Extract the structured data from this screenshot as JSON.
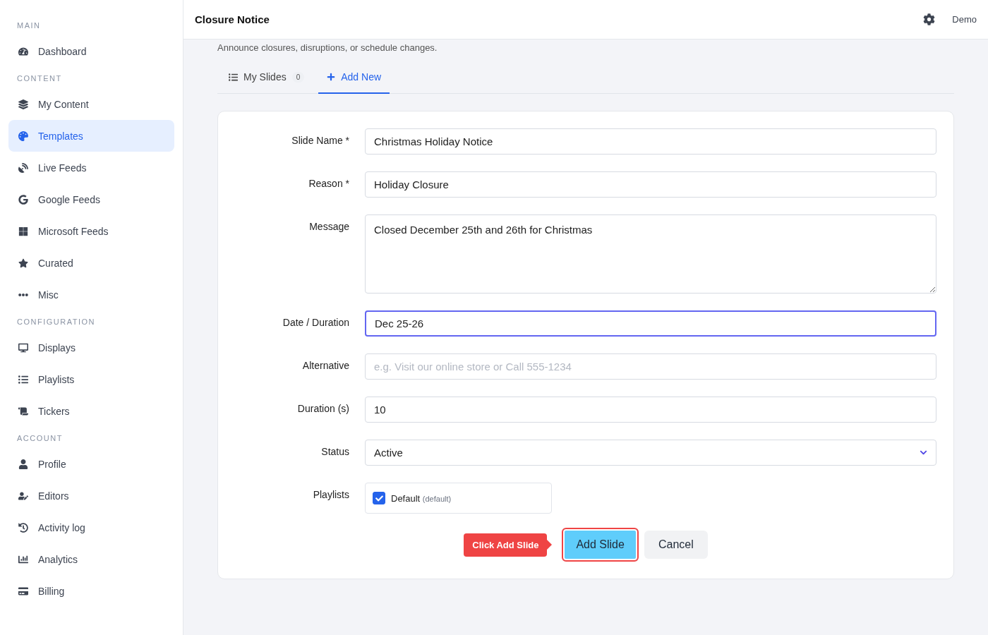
{
  "sidebar": {
    "sections": [
      {
        "heading": "MAIN",
        "items": [
          {
            "label": "Dashboard",
            "selected": false
          }
        ]
      },
      {
        "heading": "CONTENT",
        "items": [
          {
            "label": "My Content",
            "selected": false
          },
          {
            "label": "Templates",
            "selected": true
          },
          {
            "label": "Live Feeds",
            "selected": false
          },
          {
            "label": "Google Feeds",
            "selected": false
          },
          {
            "label": "Microsoft Feeds",
            "selected": false
          },
          {
            "label": "Curated",
            "selected": false
          },
          {
            "label": "Misc",
            "selected": false
          }
        ]
      },
      {
        "heading": "CONFIGURATION",
        "items": [
          {
            "label": "Displays",
            "selected": false
          },
          {
            "label": "Playlists",
            "selected": false
          },
          {
            "label": "Tickers",
            "selected": false
          }
        ]
      },
      {
        "heading": "ACCOUNT",
        "items": [
          {
            "label": "Profile",
            "selected": false
          },
          {
            "label": "Editors",
            "selected": false
          },
          {
            "label": "Activity log",
            "selected": false
          },
          {
            "label": "Analytics",
            "selected": false
          },
          {
            "label": "Billing",
            "selected": false
          }
        ]
      }
    ]
  },
  "header": {
    "title": "Closure Notice",
    "user": "Demo"
  },
  "subtitle": "Announce closures, disruptions, or schedule changes.",
  "tabs": [
    {
      "label": "My Slides",
      "count": "0",
      "selected": false
    },
    {
      "label": "Add New",
      "selected": true
    }
  ],
  "form": {
    "fields": [
      {
        "kind": "text",
        "label": "Slide Name *",
        "value": "Christmas Holiday Notice",
        "focused": false
      },
      {
        "kind": "text",
        "label": "Reason *",
        "value": "Holiday Closure",
        "focused": false
      },
      {
        "kind": "textarea",
        "label": "Message",
        "value": "Closed December 25th and 26th for Christmas"
      },
      {
        "kind": "text",
        "label": "Date / Duration",
        "value": "Dec 25-26",
        "focused": true
      },
      {
        "kind": "text",
        "label": "Alternative",
        "placeholder": "e.g. Visit our online store or Call 555-1234",
        "focused": false
      },
      {
        "kind": "text",
        "label": "Duration (s)",
        "value": "10",
        "focused": false
      },
      {
        "kind": "select",
        "label": "Status",
        "value": "Active"
      },
      {
        "kind": "checkboxes",
        "label": "Playlists",
        "options": [
          {
            "label": "Default",
            "note": "(default)",
            "checked": true
          }
        ]
      }
    ],
    "tooltip": "Click Add Slide",
    "buttons": [
      {
        "kind": "primary",
        "label": "Add Slide",
        "highlighted": true
      },
      {
        "kind": "secondary",
        "label": "Cancel",
        "highlighted": false
      }
    ]
  }
}
